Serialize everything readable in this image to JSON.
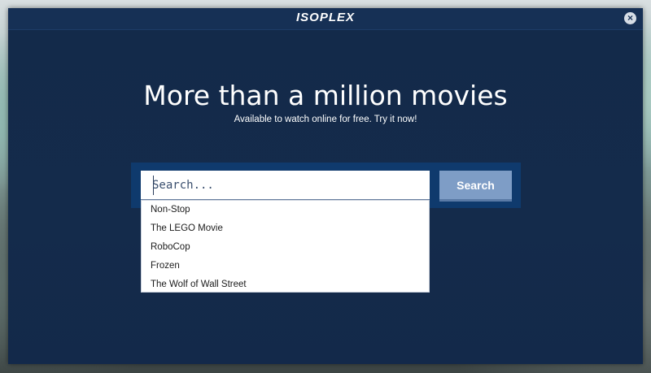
{
  "app": {
    "logo": "ISOPLEX",
    "close_symbol": "×"
  },
  "hero": {
    "title": "More than a million movies",
    "subtitle": "Available to watch online for free. Try it now!"
  },
  "search": {
    "placeholder": "Search...",
    "button_label": "Search",
    "suggestions": [
      "Non-Stop",
      "The LEGO Movie",
      "RoboCop",
      "Frozen",
      "The Wolf of Wall Street"
    ]
  },
  "colors": {
    "window_bg": "#132a4a",
    "panel_bg": "#0f3a6d",
    "button_bg": "#7e9dc6"
  },
  "icons": {
    "close": "close-icon"
  }
}
